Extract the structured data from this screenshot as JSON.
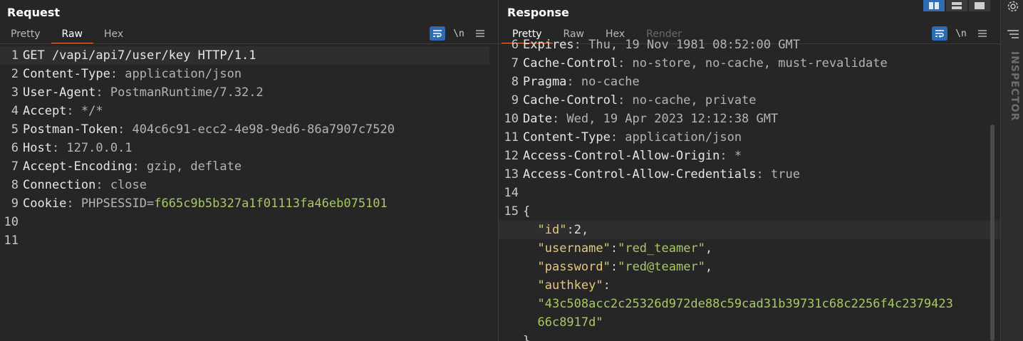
{
  "request": {
    "title": "Request",
    "tabs": [
      "Pretty",
      "Raw",
      "Hex"
    ],
    "active_tab": "Raw",
    "newline_label": "\\n",
    "lines": [
      {
        "n": "1",
        "parts": [
          [
            "hkey",
            "GET /vapi/api7/user/key HTTP/1.1"
          ]
        ]
      },
      {
        "n": "2",
        "parts": [
          [
            "hkey",
            "Content-Type"
          ],
          [
            "hval",
            ": application/json"
          ]
        ]
      },
      {
        "n": "3",
        "parts": [
          [
            "hkey",
            "User-Agent"
          ],
          [
            "hval",
            ": PostmanRuntime/7.32.2"
          ]
        ]
      },
      {
        "n": "4",
        "parts": [
          [
            "hkey",
            "Accept"
          ],
          [
            "hval",
            ": */*"
          ]
        ]
      },
      {
        "n": "5",
        "parts": [
          [
            "hkey",
            "Postman-Token"
          ],
          [
            "hval",
            ": 404c6c91-ecc2-4e98-9ed6-86a7907c7520"
          ]
        ]
      },
      {
        "n": "6",
        "parts": [
          [
            "hkey",
            "Host"
          ],
          [
            "hval",
            ": 127.0.0.1"
          ]
        ]
      },
      {
        "n": "7",
        "parts": [
          [
            "hkey",
            "Accept-Encoding"
          ],
          [
            "hval",
            ": gzip, deflate"
          ]
        ]
      },
      {
        "n": "8",
        "parts": [
          [
            "hkey",
            "Connection"
          ],
          [
            "hval",
            ": close"
          ]
        ]
      },
      {
        "n": "9",
        "parts": [
          [
            "hkey",
            "Cookie"
          ],
          [
            "hval",
            ": PHPSESSID="
          ],
          [
            "cval",
            "f665c9b5b327a1f01113fa46eb075101"
          ]
        ]
      },
      {
        "n": "10",
        "parts": []
      },
      {
        "n": "11",
        "parts": []
      }
    ]
  },
  "response": {
    "title": "Response",
    "tabs": [
      "Pretty",
      "Raw",
      "Hex",
      "Render"
    ],
    "active_tab": "Pretty",
    "disabled_tab": "Render",
    "newline_label": "\\n",
    "lines": [
      {
        "n": "6",
        "parts": [
          [
            "hkey",
            "Expires"
          ],
          [
            "hval",
            ": Thu, 19 Nov 1981 08:52:00 GMT"
          ]
        ]
      },
      {
        "n": "7",
        "parts": [
          [
            "hkey",
            "Cache-Control"
          ],
          [
            "hval",
            ": no-store, no-cache, must-revalidate"
          ]
        ]
      },
      {
        "n": "8",
        "parts": [
          [
            "hkey",
            "Pragma"
          ],
          [
            "hval",
            ": no-cache"
          ]
        ]
      },
      {
        "n": "9",
        "parts": [
          [
            "hkey",
            "Cache-Control"
          ],
          [
            "hval",
            ": no-cache, private"
          ]
        ]
      },
      {
        "n": "10",
        "parts": [
          [
            "hkey",
            "Date"
          ],
          [
            "hval",
            ": Wed, 19 Apr 2023 12:12:38 GMT"
          ]
        ]
      },
      {
        "n": "11",
        "parts": [
          [
            "hkey",
            "Content-Type"
          ],
          [
            "hval",
            ": application/json"
          ]
        ]
      },
      {
        "n": "12",
        "parts": [
          [
            "hkey",
            "Access-Control-Allow-Origin"
          ],
          [
            "hval",
            ": *"
          ]
        ]
      },
      {
        "n": "13",
        "parts": [
          [
            "hkey",
            "Access-Control-Allow-Credentials"
          ],
          [
            "hval",
            ": true"
          ]
        ]
      },
      {
        "n": "14",
        "parts": []
      },
      {
        "n": "15",
        "parts": [
          [
            "punc",
            "{"
          ]
        ]
      },
      {
        "n": "",
        "hl": true,
        "parts": [
          [
            "punc",
            "  "
          ],
          [
            "jkey",
            "\"id\""
          ],
          [
            "punc",
            ":"
          ],
          [
            "jnum",
            "2"
          ],
          [
            "punc",
            ","
          ]
        ]
      },
      {
        "n": "",
        "parts": [
          [
            "punc",
            "  "
          ],
          [
            "jkey",
            "\"username\""
          ],
          [
            "punc",
            ":"
          ],
          [
            "jstr",
            "\"red_teamer\""
          ],
          [
            "punc",
            ","
          ]
        ]
      },
      {
        "n": "",
        "parts": [
          [
            "punc",
            "  "
          ],
          [
            "jkey",
            "\"password\""
          ],
          [
            "punc",
            ":"
          ],
          [
            "jstr",
            "\"red@teamer\""
          ],
          [
            "punc",
            ","
          ]
        ]
      },
      {
        "n": "",
        "parts": [
          [
            "punc",
            "  "
          ],
          [
            "jkey",
            "\"authkey\""
          ],
          [
            "punc",
            ":"
          ]
        ]
      },
      {
        "n": "",
        "parts": [
          [
            "punc",
            "  "
          ],
          [
            "jstr",
            "\"43c508acc2c25326d972de88c59cad31b39731c68c2256f4c2379423"
          ]
        ]
      },
      {
        "n": "",
        "parts": [
          [
            "punc",
            "  "
          ],
          [
            "jstr",
            "66c8917d\""
          ]
        ]
      },
      {
        "n": "",
        "parts": [
          [
            "punc",
            "}"
          ]
        ]
      }
    ]
  },
  "inspector": {
    "label": "INSPECTOR",
    "icons": [
      "gear-icon",
      "menu-lines-icon"
    ]
  },
  "colors": {
    "accent": "#e8703a",
    "wrap_active": "#2f6bb0",
    "json_key": "#e6c87a",
    "json_string": "#a8c866"
  }
}
